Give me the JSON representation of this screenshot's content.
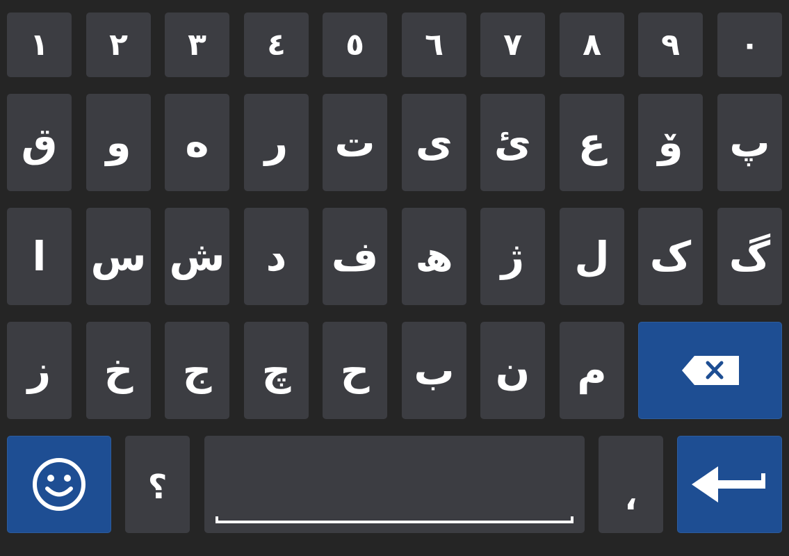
{
  "keyboard": {
    "row1": [
      "١",
      "٢",
      "٣",
      "٤",
      "٥",
      "٦",
      "٧",
      "٨",
      "٩",
      "٠"
    ],
    "row2": [
      "ق",
      "و",
      "ە",
      "ر",
      "ت",
      "ی",
      "ئ",
      "ع",
      "ۆ",
      "پ"
    ],
    "row3": [
      "ا",
      "س",
      "ش",
      "د",
      "ف",
      "ھ",
      "ژ",
      "ل",
      "ک",
      "گ"
    ],
    "row4": [
      "ز",
      "خ",
      "ج",
      "چ",
      "ح",
      "ب",
      "ن",
      "م"
    ],
    "row5": {
      "question": "؟",
      "comma": "،"
    },
    "icons": {
      "backspace": "backspace-icon",
      "emoji": "emoji-icon",
      "enter": "enter-icon",
      "space": "space-icon"
    },
    "colors": {
      "background": "#252525",
      "key": "#3c3d42",
      "accent": "#1e4e93",
      "text": "#ffffff"
    }
  }
}
